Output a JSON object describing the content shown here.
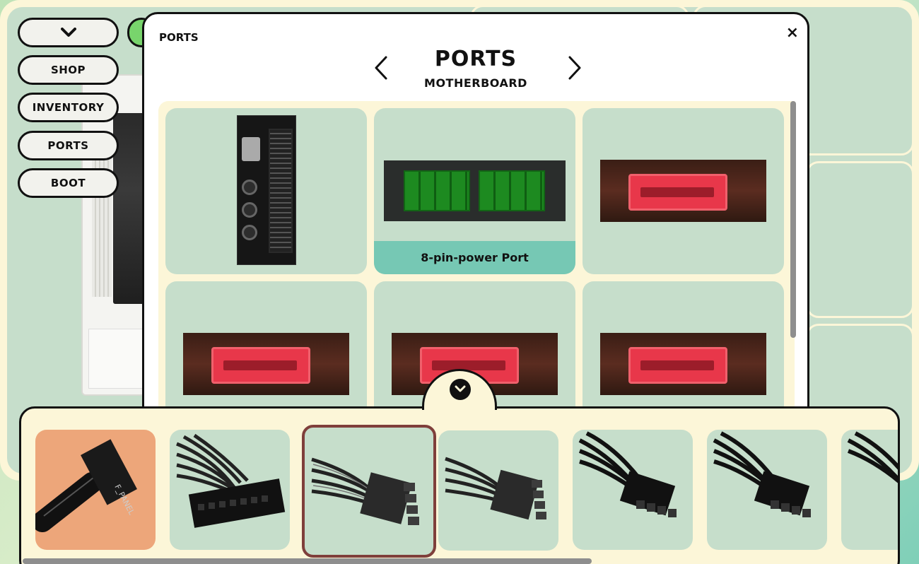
{
  "sidebar": {
    "buttons": [
      {
        "label": "SHOP"
      },
      {
        "label": "INVENTORY"
      },
      {
        "label": "PORTS"
      },
      {
        "label": "BOOT"
      }
    ]
  },
  "modal": {
    "small_title": "PORTS",
    "close_glyph": "×",
    "title": "PORTS",
    "subtitle": "MOTHERBOARD",
    "ports": [
      {
        "image": "24-pin-atx-port",
        "label": ""
      },
      {
        "image": "8-pin-power-port",
        "label": "8-pin-power Port"
      },
      {
        "image": "sata-port",
        "label": ""
      },
      {
        "image": "sata-port",
        "label": ""
      },
      {
        "image": "sata-port",
        "label": ""
      },
      {
        "image": "sata-port",
        "label": ""
      }
    ]
  },
  "tray": {
    "cables": [
      {
        "image": "f-panel-cable",
        "selected": false,
        "highlight": "orange",
        "print": "F_PANEL"
      },
      {
        "image": "24-pin-atx-cable",
        "selected": false
      },
      {
        "image": "8-pin-power-cable",
        "selected": true
      },
      {
        "image": "8-pin-power-cable",
        "selected": false
      },
      {
        "image": "8-pin-pcie-cable",
        "selected": false
      },
      {
        "image": "8-pin-pcie-cable",
        "selected": false
      },
      {
        "image": "8-pin-pcie-cable",
        "selected": false
      }
    ]
  },
  "colors": {
    "panel_green": "#c6decb",
    "cream": "#fcf6d8",
    "label_teal": "#76c8b4",
    "orange": "#eda67a",
    "selected_border": "#7f3f3b",
    "sata_red": "#e8374a"
  }
}
